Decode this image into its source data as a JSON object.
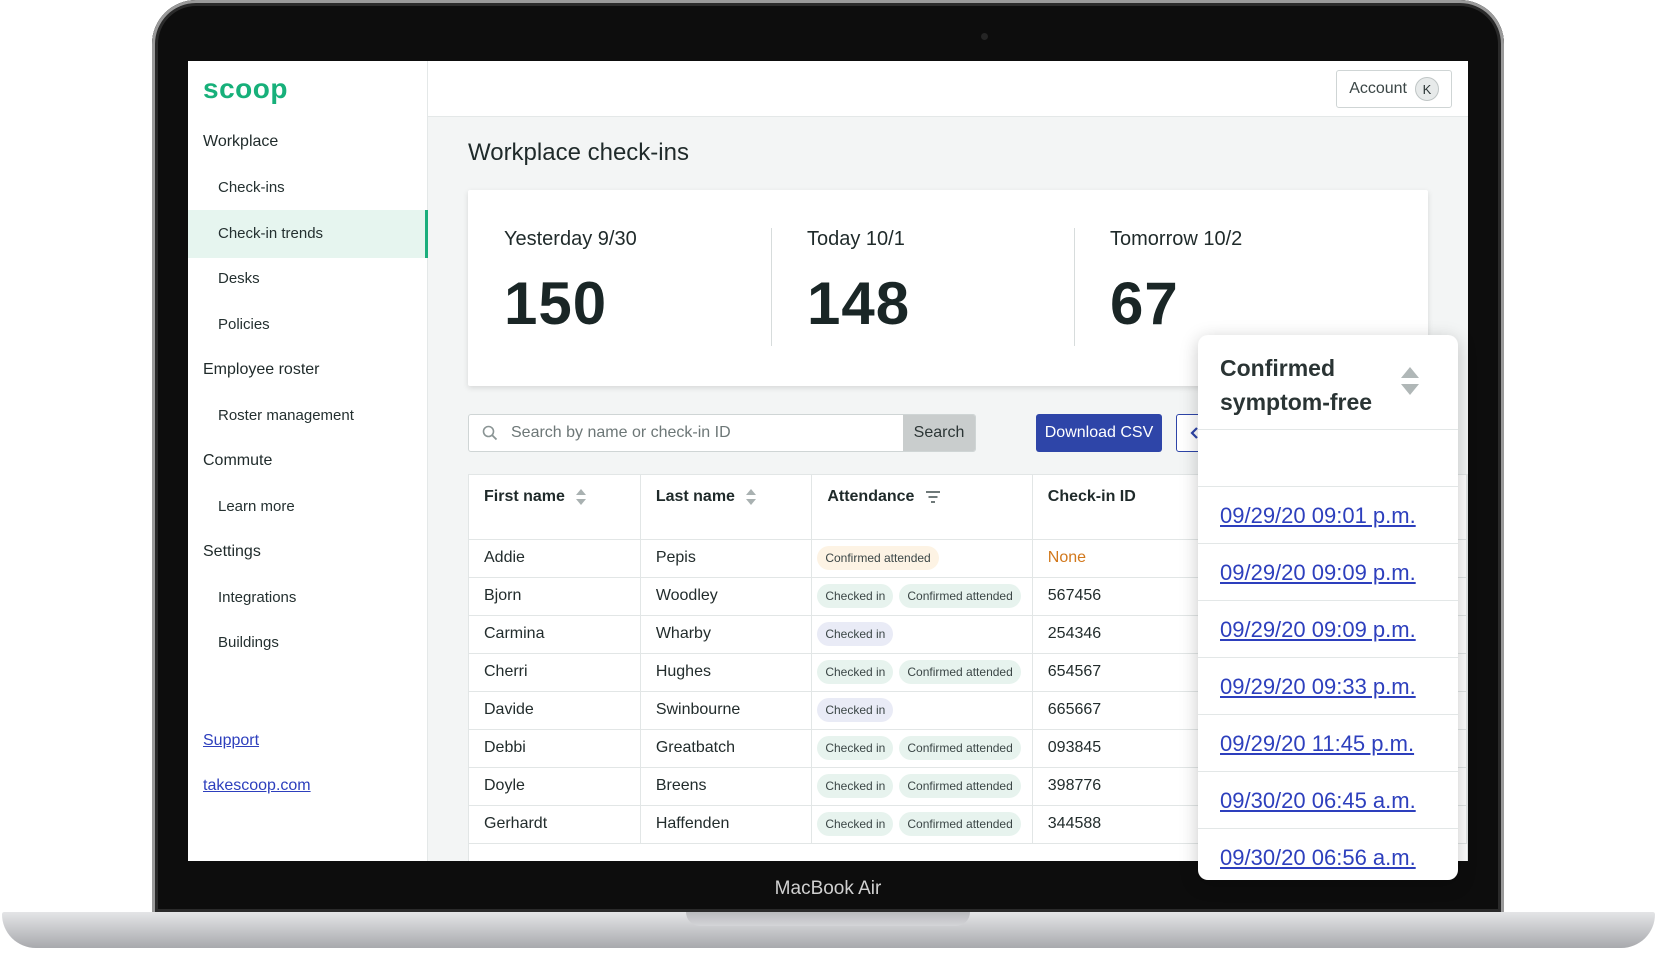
{
  "device": {
    "label": "MacBook Air"
  },
  "sidebar": {
    "logo": "scoop",
    "sections": [
      {
        "title": "Workplace",
        "items": [
          "Check-ins",
          "Check-in trends",
          "Desks",
          "Policies"
        ]
      },
      {
        "title": "Employee roster",
        "items": [
          "Roster management"
        ]
      },
      {
        "title": "Commute",
        "items": [
          "Learn more"
        ]
      },
      {
        "title": "Settings",
        "items": [
          "Integrations",
          "Buildings"
        ]
      }
    ],
    "active_item": "Check-in trends",
    "links": [
      "Support",
      "takescoop.com"
    ]
  },
  "topbar": {
    "account_label": "Account",
    "avatar_initial": "K"
  },
  "main": {
    "title": "Workplace check-ins",
    "stats": [
      {
        "label": "Yesterday 9/30",
        "value": "150"
      },
      {
        "label": "Today 10/1",
        "value": "148"
      },
      {
        "label": "Tomorrow 10/2",
        "value": "67"
      }
    ],
    "search": {
      "placeholder": "Search by name or check-in ID",
      "button_label": "Search"
    },
    "download_label": "Download CSV",
    "table": {
      "columns": [
        "First name",
        "Last name",
        "Attendance",
        "Check-in ID"
      ],
      "rows": [
        {
          "first": "Addie",
          "last": "Pepis",
          "attendance": [
            "Confirmed attended"
          ],
          "id": "None"
        },
        {
          "first": "Bjorn",
          "last": "Woodley",
          "attendance": [
            "Checked in",
            "Confirmed attended"
          ],
          "id": "567456"
        },
        {
          "first": "Carmina",
          "last": "Wharby",
          "attendance": [
            "Checked in"
          ],
          "id": "254346"
        },
        {
          "first": "Cherri",
          "last": "Hughes",
          "attendance": [
            "Checked in",
            "Confirmed attended"
          ],
          "id": "654567"
        },
        {
          "first": "Davide",
          "last": "Swinbourne",
          "attendance": [
            "Checked in"
          ],
          "id": "665667"
        },
        {
          "first": "Debbi",
          "last": "Greatbatch",
          "attendance": [
            "Checked in",
            "Confirmed attended"
          ],
          "id": "093845"
        },
        {
          "first": "Doyle",
          "last": "Breens",
          "attendance": [
            "Checked in",
            "Confirmed attended"
          ],
          "id": "398776"
        },
        {
          "first": "Gerhardt",
          "last": "Haffenden",
          "attendance": [
            "Checked in",
            "Confirmed attended"
          ],
          "id": "344588"
        }
      ]
    }
  },
  "popout": {
    "title": "Confirmed symptom-free",
    "entries": [
      "09/29/20 09:01 p.m.",
      "09/29/20 09:09 p.m.",
      "09/29/20 09:09 p.m.",
      "09/29/20 09:33 p.m.",
      "09/29/20 11:45 p.m.",
      "09/30/20 06:45 a.m.",
      "09/30/20 06:56 a.m."
    ]
  },
  "colors": {
    "brand": "#17b07a",
    "primary": "#2e45a8",
    "link": "#2d3fbd",
    "warning": "#d2781c"
  }
}
